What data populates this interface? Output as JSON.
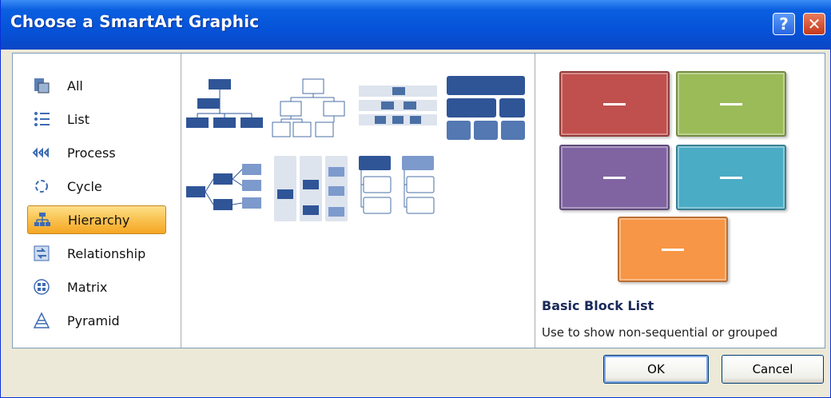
{
  "window": {
    "title": "Choose a SmartArt Graphic",
    "help_label": "?",
    "close_label": "✕"
  },
  "sidebar": {
    "items": [
      {
        "label": "All",
        "icon": "all-icon"
      },
      {
        "label": "List",
        "icon": "list-icon"
      },
      {
        "label": "Process",
        "icon": "process-icon"
      },
      {
        "label": "Cycle",
        "icon": "cycle-icon"
      },
      {
        "label": "Hierarchy",
        "icon": "hierarchy-icon",
        "selected": true
      },
      {
        "label": "Relationship",
        "icon": "relationship-icon"
      },
      {
        "label": "Matrix",
        "icon": "matrix-icon"
      },
      {
        "label": "Pyramid",
        "icon": "pyramid-icon"
      }
    ]
  },
  "preview": {
    "title": "Basic Block List",
    "description": "Use to show non-sequential or grouped",
    "block_colors": [
      "#c0504d",
      "#9bbb59",
      "#8064a2",
      "#4bacc6",
      "#f79646"
    ]
  },
  "buttons": {
    "ok": "OK",
    "cancel": "Cancel"
  },
  "colors": {
    "titlebar": "#0653d8",
    "selected": "#f9c24f",
    "dark_node": "#2f5597",
    "light_node": "#9fb4cf"
  }
}
